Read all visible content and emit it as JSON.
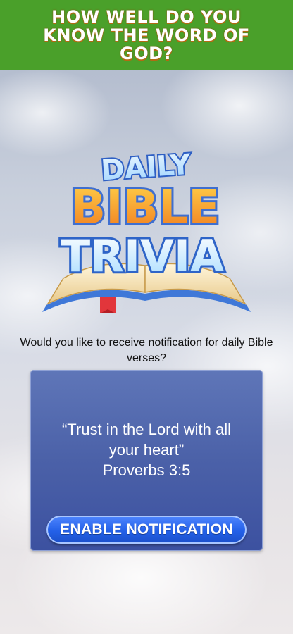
{
  "banner": {
    "headline": "HOW WELL DO YOU KNOW THE WORD OF GOD?"
  },
  "logo": {
    "line1": "DAILY",
    "line2": "BIBLE",
    "line3": "TRIVIA"
  },
  "prompt": {
    "text": "Would you like to receive notification for daily Bible verses?"
  },
  "card": {
    "quote_line1": "“Trust in the Lord with all",
    "quote_line2": "your heart”",
    "reference": "Proverbs 3:5",
    "button_label": "ENABLE NOTIFICATION"
  },
  "colors": {
    "banner_green": "#4aa02a",
    "card_blue": "#4b61a8",
    "button_blue": "#2360e8",
    "logo_orange": "#f08a2a",
    "logo_blue": "#3f78d8"
  }
}
